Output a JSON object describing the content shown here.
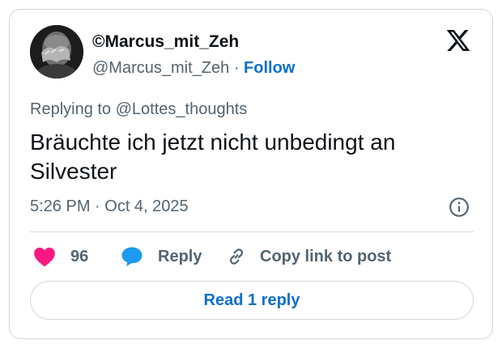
{
  "post": {
    "author_name": "©Marcus_mit_Zeh",
    "author_handle": "@Marcus_mit_Zeh",
    "separator": "·",
    "follow_label": "Follow",
    "replying_prefix": "Replying to ",
    "replying_to": "@Lottes_thoughts",
    "text": "Bräuchte ich jetzt nicht unbedingt an Silvester",
    "timestamp": "5:26 PM · Oct 4, 2025"
  },
  "actions": {
    "like_count": "96",
    "reply_label": "Reply",
    "copy_link_label": "Copy link to post"
  },
  "read_replies_label": "Read 1 reply",
  "icons": {
    "brand": "x-logo-icon",
    "info": "info-icon",
    "like": "heart-icon",
    "reply": "speech-bubble-icon",
    "copy": "link-icon"
  },
  "colors": {
    "link_blue": "#0f6fcf",
    "heart_pink": "#f91880",
    "reply_blue": "#1d9bf0",
    "muted_text": "#536471",
    "border": "#cfd9de"
  }
}
